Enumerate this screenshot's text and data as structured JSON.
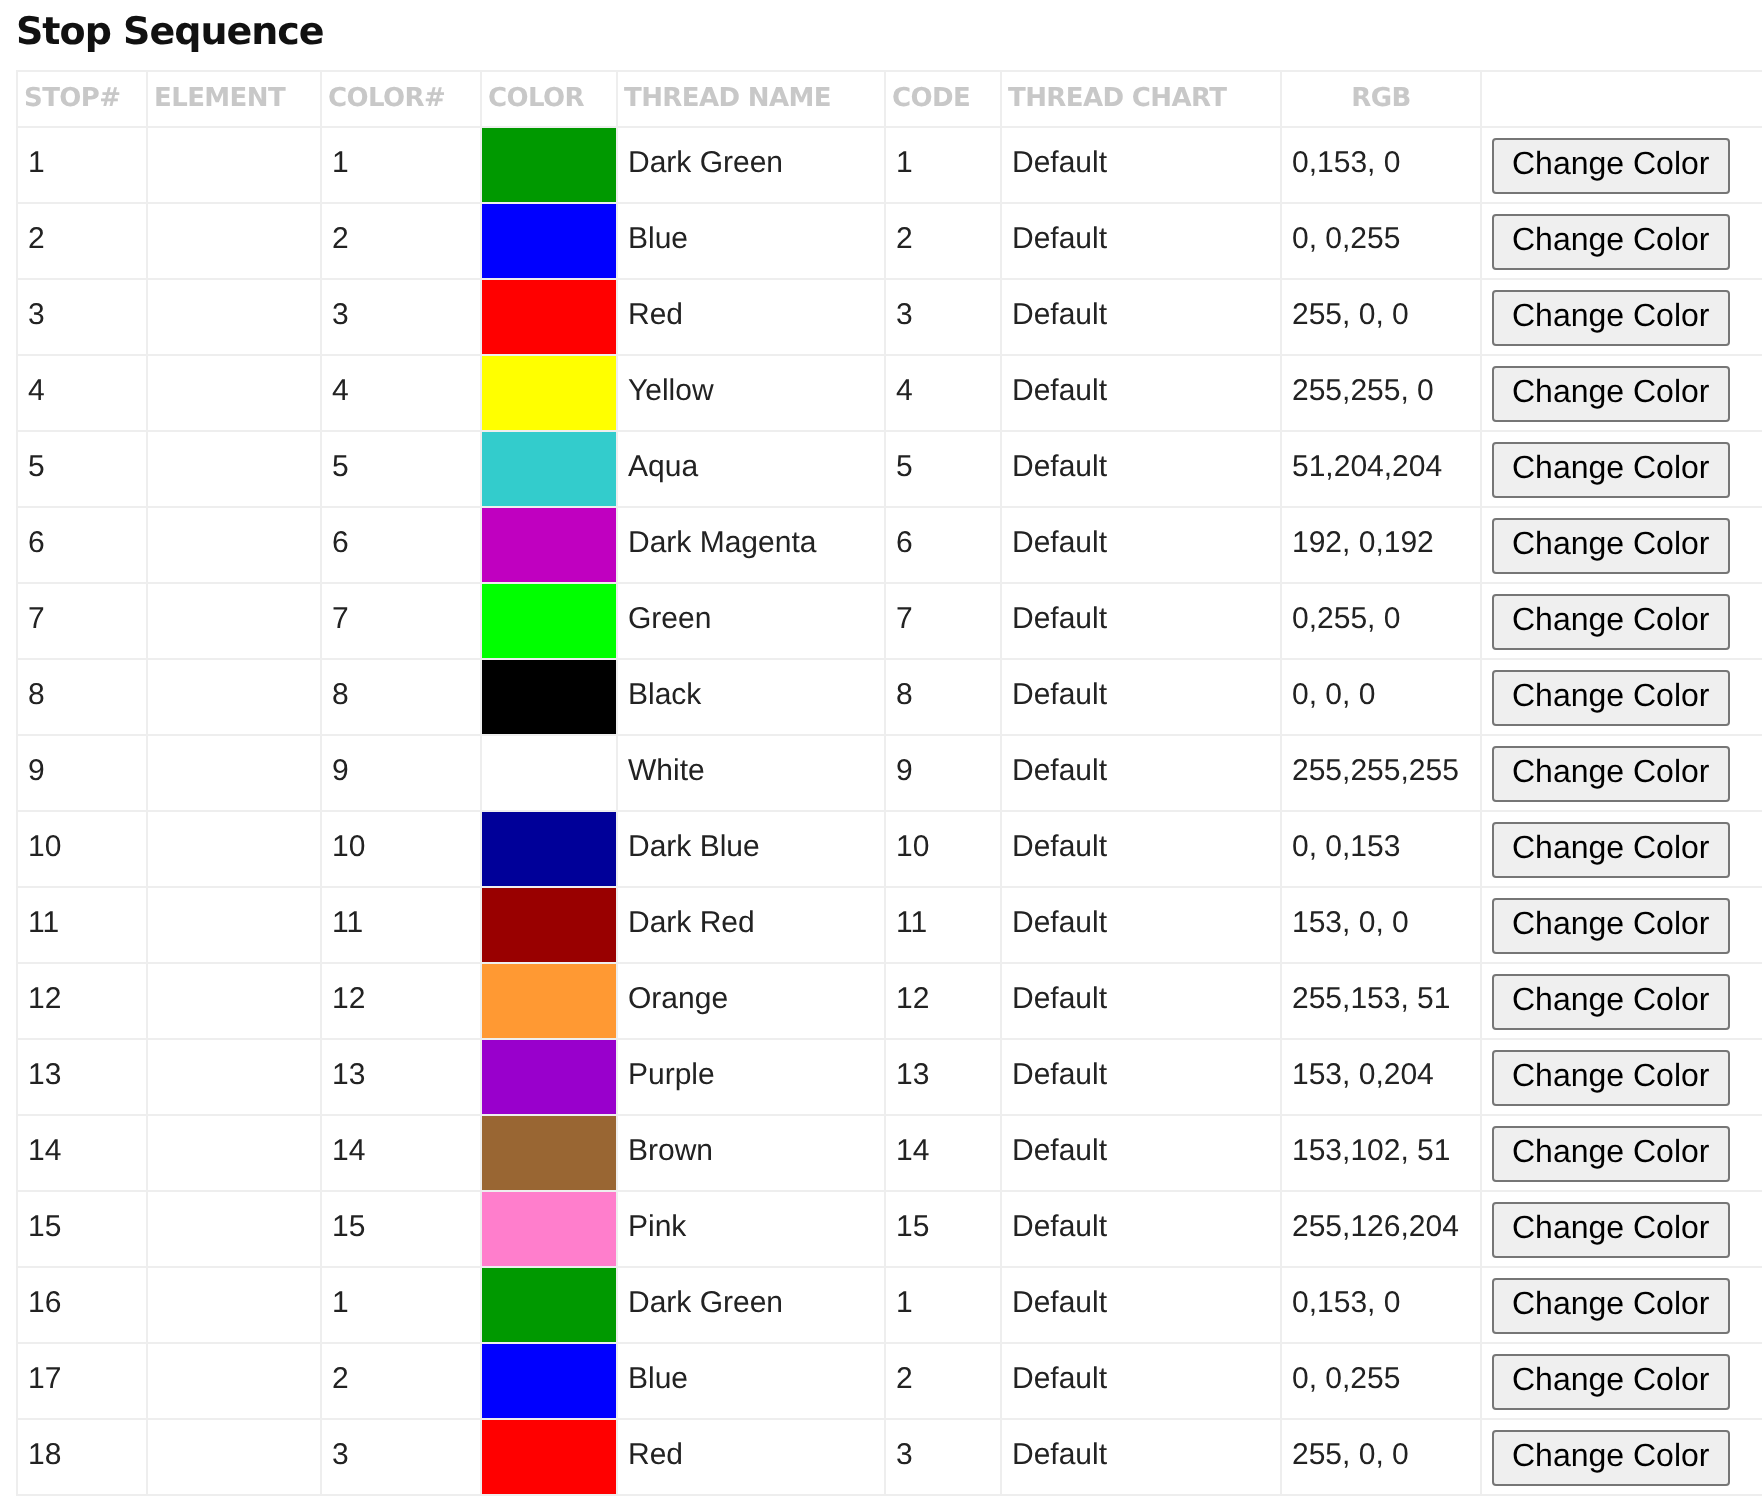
{
  "title": "Stop Sequence",
  "columns": [
    "STOP#",
    "ELEMENT",
    "COLOR#",
    "COLOR",
    "THREAD NAME",
    "CODE",
    "THREAD CHART",
    "RGB"
  ],
  "rows": [
    {
      "stop": "1",
      "color_num": "1",
      "color": "#009900",
      "thread_name": "Dark Green",
      "code": "1",
      "chart": "Default",
      "rgb": "0,153, 0",
      "button": "Change Color"
    },
    {
      "stop": "2",
      "color_num": "2",
      "color": "#0000ff",
      "thread_name": "Blue",
      "code": "2",
      "chart": "Default",
      "rgb": "0, 0,255",
      "button": "Change Color"
    },
    {
      "stop": "3",
      "color_num": "3",
      "color": "#ff0000",
      "thread_name": "Red",
      "code": "3",
      "chart": "Default",
      "rgb": "255, 0, 0",
      "button": "Change Color"
    },
    {
      "stop": "4",
      "color_num": "4",
      "color": "#ffff00",
      "thread_name": "Yellow",
      "code": "4",
      "chart": "Default",
      "rgb": "255,255, 0",
      "button": "Change Color"
    },
    {
      "stop": "5",
      "color_num": "5",
      "color": "#33cccc",
      "thread_name": "Aqua",
      "code": "5",
      "chart": "Default",
      "rgb": "51,204,204",
      "button": "Change Color"
    },
    {
      "stop": "6",
      "color_num": "6",
      "color": "#c000c0",
      "thread_name": "Dark Magenta",
      "code": "6",
      "chart": "Default",
      "rgb": "192, 0,192",
      "button": "Change Color"
    },
    {
      "stop": "7",
      "color_num": "7",
      "color": "#00ff00",
      "thread_name": "Green",
      "code": "7",
      "chart": "Default",
      "rgb": "0,255, 0",
      "button": "Change Color"
    },
    {
      "stop": "8",
      "color_num": "8",
      "color": "#000000",
      "thread_name": "Black",
      "code": "8",
      "chart": "Default",
      "rgb": "0, 0, 0",
      "button": "Change Color"
    },
    {
      "stop": "9",
      "color_num": "9",
      "color": "#ffffff",
      "thread_name": "White",
      "code": "9",
      "chart": "Default",
      "rgb": "255,255,255",
      "button": "Change Color"
    },
    {
      "stop": "10",
      "color_num": "10",
      "color": "#000099",
      "thread_name": "Dark Blue",
      "code": "10",
      "chart": "Default",
      "rgb": "0, 0,153",
      "button": "Change Color"
    },
    {
      "stop": "11",
      "color_num": "11",
      "color": "#990000",
      "thread_name": "Dark Red",
      "code": "11",
      "chart": "Default",
      "rgb": "153, 0, 0",
      "button": "Change Color"
    },
    {
      "stop": "12",
      "color_num": "12",
      "color": "#ff9933",
      "thread_name": "Orange",
      "code": "12",
      "chart": "Default",
      "rgb": "255,153, 51",
      "button": "Change Color"
    },
    {
      "stop": "13",
      "color_num": "13",
      "color": "#9900cc",
      "thread_name": "Purple",
      "code": "13",
      "chart": "Default",
      "rgb": "153, 0,204",
      "button": "Change Color"
    },
    {
      "stop": "14",
      "color_num": "14",
      "color": "#996633",
      "thread_name": "Brown",
      "code": "14",
      "chart": "Default",
      "rgb": "153,102, 51",
      "button": "Change Color"
    },
    {
      "stop": "15",
      "color_num": "15",
      "color": "#ff7ecc",
      "thread_name": "Pink",
      "code": "15",
      "chart": "Default",
      "rgb": "255,126,204",
      "button": "Change Color"
    },
    {
      "stop": "16",
      "color_num": "1",
      "color": "#009900",
      "thread_name": "Dark Green",
      "code": "1",
      "chart": "Default",
      "rgb": "0,153, 0",
      "button": "Change Color"
    },
    {
      "stop": "17",
      "color_num": "2",
      "color": "#0000ff",
      "thread_name": "Blue",
      "code": "2",
      "chart": "Default",
      "rgb": "0, 0,255",
      "button": "Change Color"
    },
    {
      "stop": "18",
      "color_num": "3",
      "color": "#ff0000",
      "thread_name": "Red",
      "code": "3",
      "chart": "Default",
      "rgb": "255, 0, 0",
      "button": "Change Color"
    }
  ]
}
